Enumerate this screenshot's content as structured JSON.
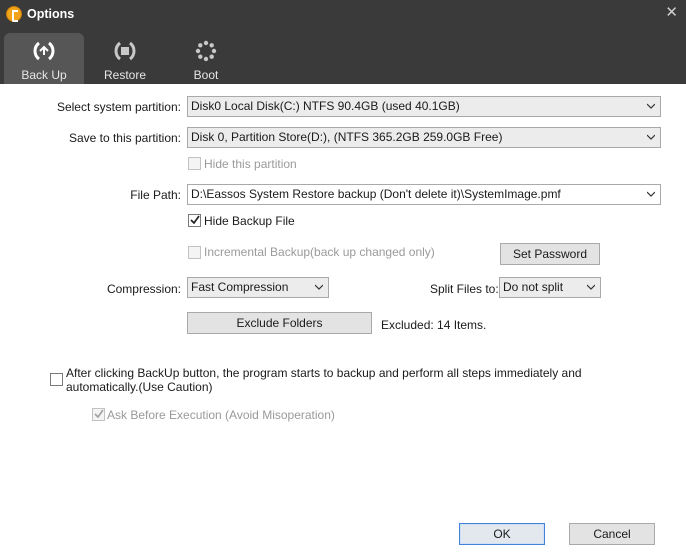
{
  "window": {
    "title": "Options",
    "close_glyph": "✕"
  },
  "tabs": [
    {
      "label": "Back Up",
      "icon": "backup-icon",
      "active": true
    },
    {
      "label": "Restore",
      "icon": "restore-icon",
      "active": false
    },
    {
      "label": "Boot",
      "icon": "boot-icon",
      "active": false
    }
  ],
  "form": {
    "system_partition": {
      "label": "Select system partition:",
      "value": "Disk0  Local Disk(C:) NTFS 90.4GB (used 40.1GB)"
    },
    "save_partition": {
      "label": "Save to this partition:",
      "value": "Disk 0, Partition Store(D:), (NTFS 365.2GB 259.0GB Free)"
    },
    "hide_partition": {
      "label": "Hide this partition",
      "checked": false,
      "disabled": true
    },
    "file_path": {
      "label": "File Path:",
      "value": "D:\\Eassos System Restore backup (Don't delete it)\\SystemImage.pmf"
    },
    "hide_backup_file": {
      "label": "Hide Backup File",
      "checked": true,
      "disabled": false
    },
    "incremental_backup": {
      "label": "Incremental Backup(back up changed only)",
      "checked": false,
      "disabled": true
    },
    "set_password_label": "Set Password",
    "compression": {
      "label": "Compression:",
      "value": "Fast Compression"
    },
    "split_files": {
      "label": "Split Files to:",
      "value": "Do not split"
    },
    "exclude_folders_label": "Exclude Folders",
    "excluded_text": "Excluded: 14 Items.",
    "auto_backup": {
      "label": "After clicking BackUp button, the program starts to backup and perform all steps immediately and automatically.(Use Caution)",
      "checked": false
    },
    "ask_before": {
      "label": "Ask Before Execution (Avoid Misoperation)",
      "checked": true,
      "disabled": true
    }
  },
  "footer": {
    "ok_label": "OK",
    "cancel_label": "Cancel"
  },
  "colors": {
    "titlebar": "#3a3a3a",
    "active_tab": "#565656",
    "accent": "#3f82d6",
    "logo": "#f2a31c"
  }
}
